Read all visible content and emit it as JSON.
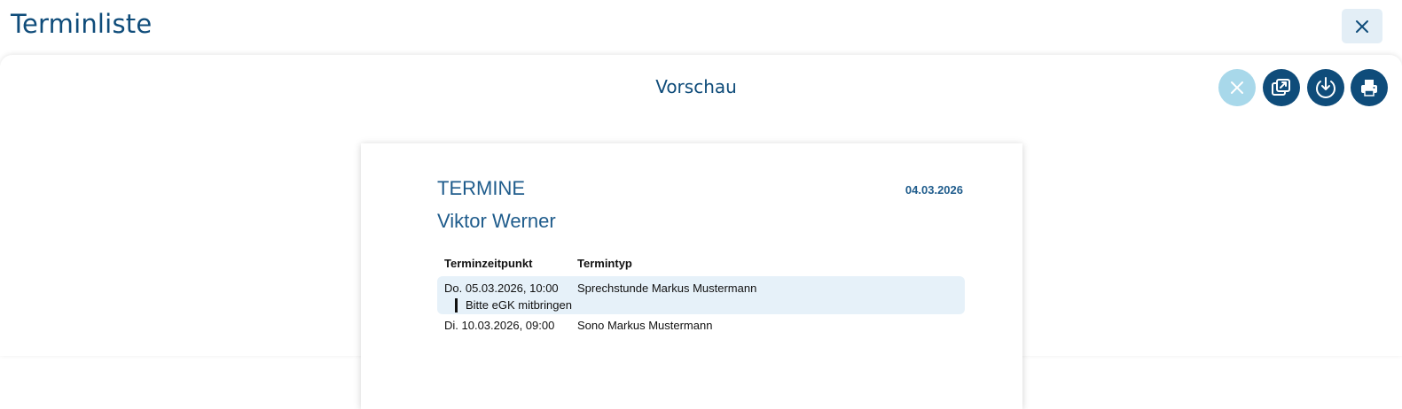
{
  "header": {
    "title": "Terminliste",
    "close_icon": "close-icon"
  },
  "preview": {
    "title": "Vorschau",
    "actions": [
      {
        "name": "cancel",
        "icon": "close-icon",
        "enabled": false
      },
      {
        "name": "open-external",
        "icon": "external-link-icon",
        "enabled": true
      },
      {
        "name": "download",
        "icon": "download-icon",
        "enabled": true
      },
      {
        "name": "print",
        "icon": "print-icon",
        "enabled": true
      }
    ]
  },
  "document": {
    "heading": "TERMINE",
    "date": "04.03.2026",
    "patient": "Viktor Werner",
    "columns": [
      "Terminzeitpunkt",
      "Termintyp"
    ],
    "rows": [
      {
        "time": "Do. 05.03.2026, 10:00",
        "type": "Sprechstunde Markus Mustermann",
        "note": "Bitte eGK mitbringen"
      },
      {
        "time": "Di. 10.03.2026, 09:00",
        "type": "Sono Markus Mustermann",
        "note": ""
      }
    ]
  },
  "colors": {
    "primary": "#0f4c7a",
    "doc_text": "#1f5c8c",
    "disabled_button": "#a8d8ea",
    "row_highlight": "#e6f1f9",
    "close_bg": "#e3eef6"
  }
}
